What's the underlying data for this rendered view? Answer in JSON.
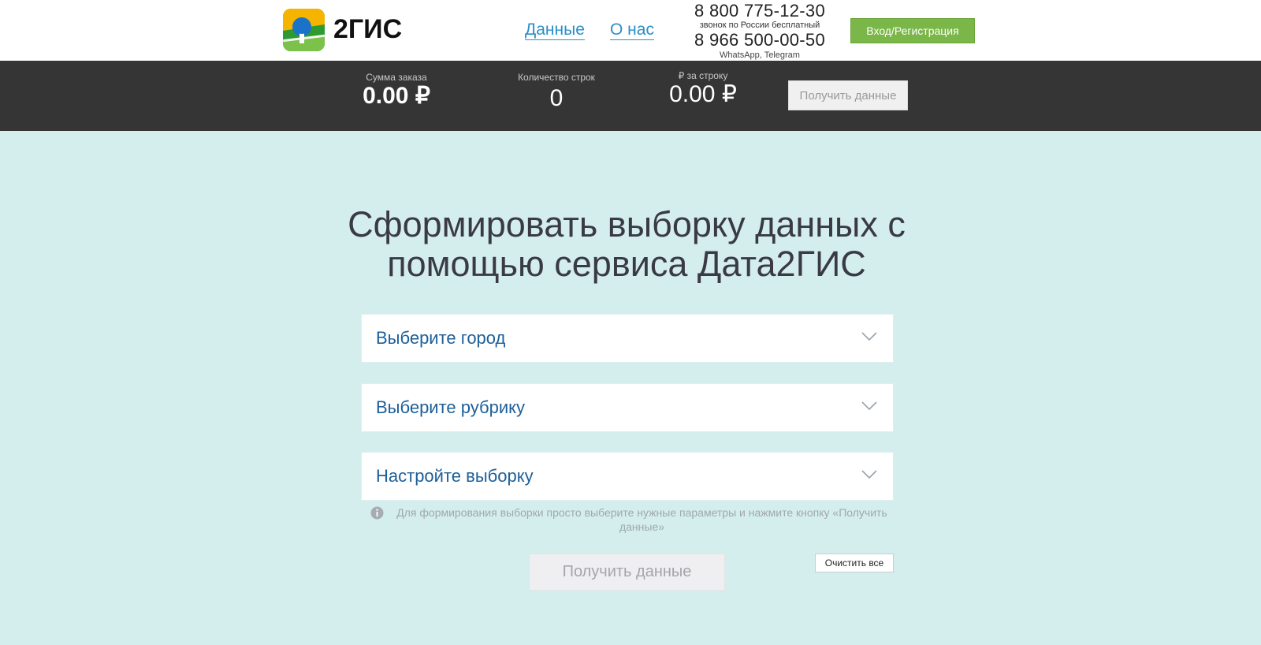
{
  "header": {
    "logo_text": "2ГИС",
    "logo_icon": "2gis-logo-icon",
    "nav": [
      {
        "label": "Данные"
      },
      {
        "label": "О нас"
      }
    ],
    "phone_primary": "8 800 775-12-30",
    "phone_primary_note": "звонок по России бесплатный",
    "phone_secondary": "8 966 500-00-50",
    "phone_secondary_note": "WhatsApp, Telegram",
    "login_label": "Вход/Регистрация",
    "login_color": "#7ab648"
  },
  "summary": {
    "order_label": "Сумма заказа",
    "order_value": "0.00 ₽",
    "rows_label": "Количество строк",
    "rows_value": "0",
    "per_row_label": "₽ за строку",
    "per_row_value": "0.00 ₽",
    "get_data_label": "Получить данные"
  },
  "main": {
    "title": "Сформировать выборку данных с помощью сервиса Дата2ГИС",
    "selects": [
      {
        "label": "Выберите город"
      },
      {
        "label": "Выберите рубрику"
      },
      {
        "label": "Настройте выборку"
      }
    ],
    "hint": "Для формирования выборки просто выберите нужные параметры и нажмите кнопку «Получить данные»",
    "get_data_label": "Получить данные",
    "clear_label": "Очистить все",
    "background_color": "#d4eeee"
  }
}
